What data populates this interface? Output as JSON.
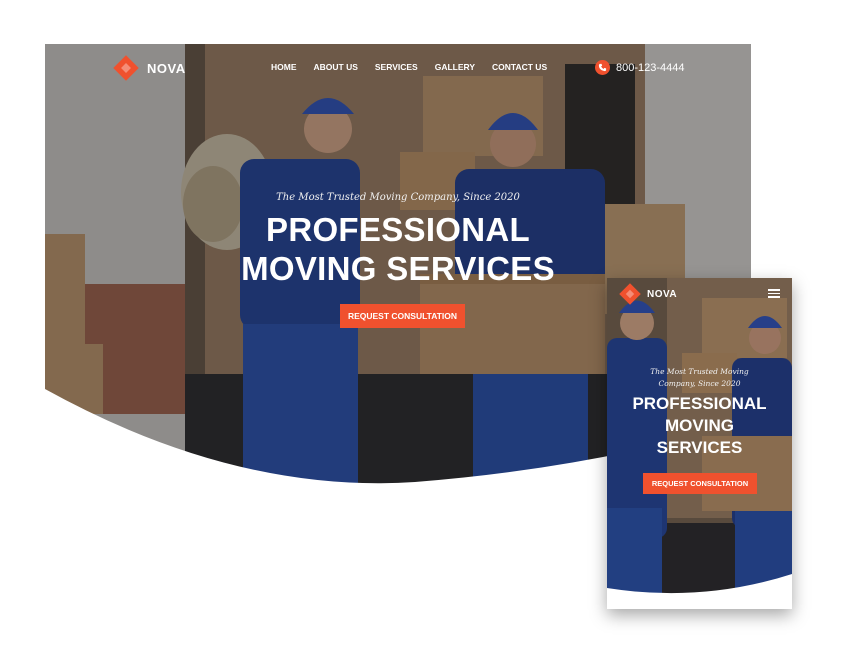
{
  "brand": {
    "name": "NOVA",
    "accent": "#f0512e"
  },
  "desktop": {
    "nav": [
      "HOME",
      "ABOUT US",
      "SERVICES",
      "GALLERY",
      "CONTACT US"
    ],
    "phone": "800-123-4444",
    "tagline": "The Most Trusted Moving Company, Since 2020",
    "title_line1": "PROFESSIONAL",
    "title_line2": "MOVING SERVICES",
    "cta": "REQUEST CONSULTATION"
  },
  "mobile": {
    "tagline_line1": "The Most Trusted Moving",
    "tagline_line2": "Company, Since 2020",
    "title_line1": "PROFESSIONAL",
    "title_line2": "MOVING",
    "title_line3": "SERVICES",
    "cta": "REQUEST CONSULTATION",
    "menu_icon": "hamburger-menu-icon"
  },
  "icons": {
    "logo": "diamond-logo-icon",
    "phone": "phone-icon"
  }
}
